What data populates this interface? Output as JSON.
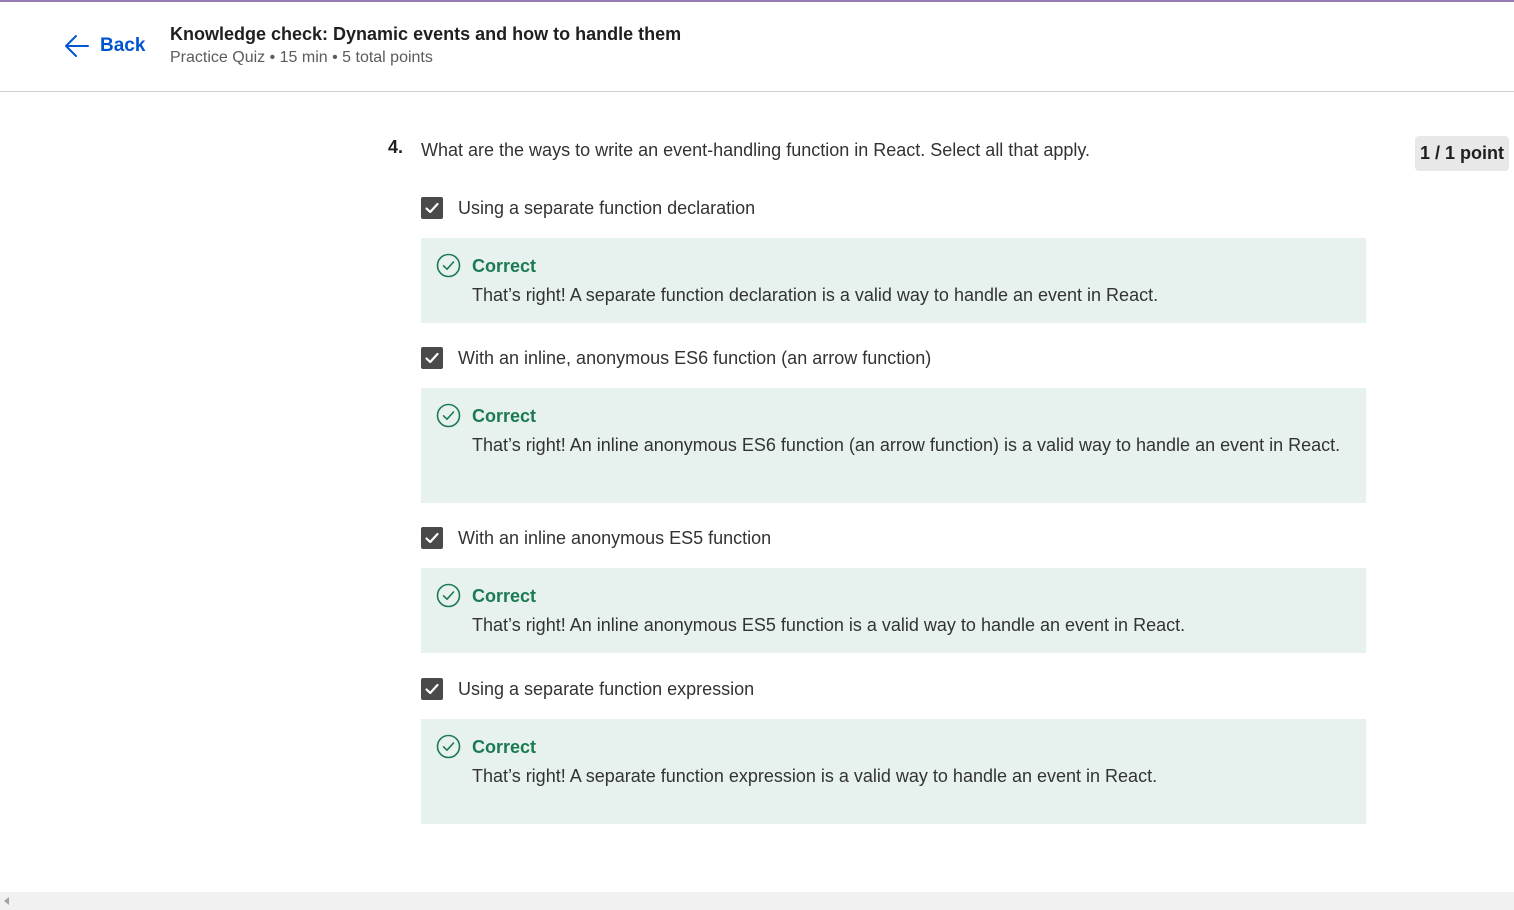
{
  "header": {
    "back_label": "Back",
    "title": "Knowledge check: Dynamic events and how to handle them",
    "meta": "Practice Quiz • 15 min • 5 total points"
  },
  "question": {
    "number": "4.",
    "text": "What are the ways to write an event-handling function in React. Select all that apply.",
    "points": "1 / 1 point",
    "options": [
      {
        "label": "Using a separate function declaration",
        "checked": true,
        "feedback_title": "Correct",
        "feedback_text": "That’s right! A separate function declaration is a valid way to handle an event in React."
      },
      {
        "label": "With an inline, anonymous ES6 function (an arrow function)",
        "checked": true,
        "feedback_title": "Correct",
        "feedback_text": "That’s right! An inline anonymous ES6 function (an arrow function) is a valid way to handle an event in React."
      },
      {
        "label": "With an inline anonymous ES5 function",
        "checked": true,
        "feedback_title": "Correct",
        "feedback_text": "That’s right! An inline anonymous ES5 function is a valid way to handle an event in React."
      },
      {
        "label": "Using a separate function expression",
        "checked": true,
        "feedback_title": "Correct",
        "feedback_text": "That’s right! A separate function expression is a valid way to handle an event in React."
      }
    ]
  },
  "colors": {
    "link": "#0056d2",
    "correct": "#1b7a52",
    "feedback_bg": "#e7f2ee",
    "checkbox": "#4a4a4a"
  },
  "icons": {
    "back": "arrow-left-icon",
    "checkbox": "checkmark-icon",
    "feedback": "check-circle-icon"
  }
}
